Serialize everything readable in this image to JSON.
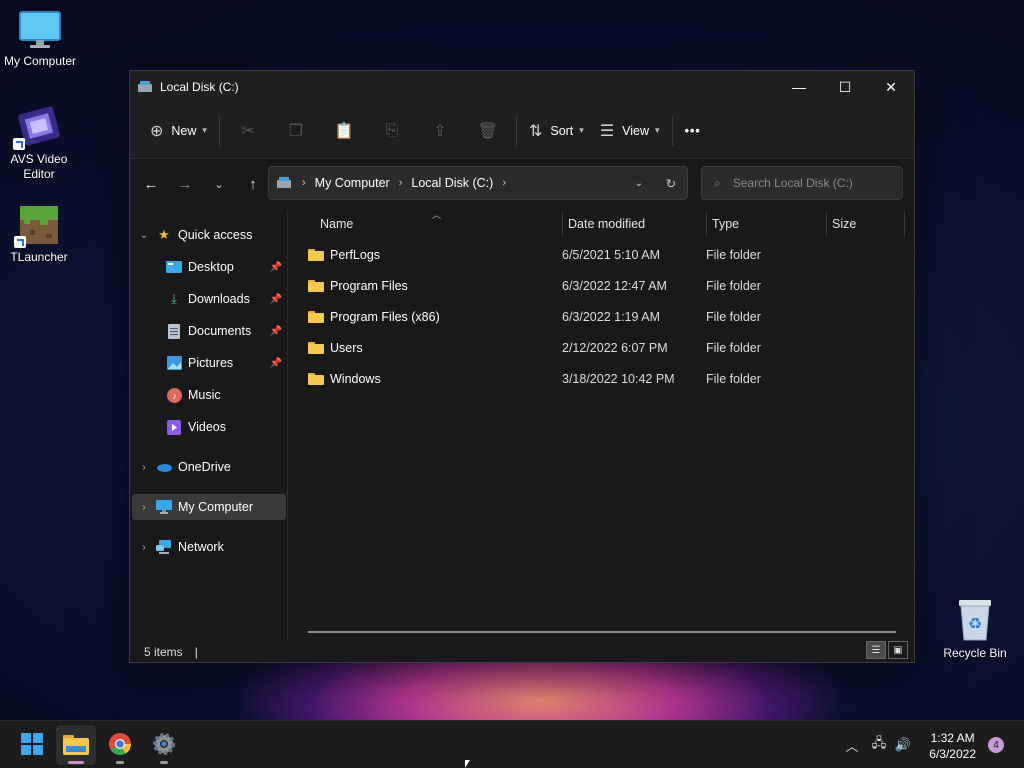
{
  "desktop": {
    "icons": [
      {
        "label": "My Computer",
        "icon": "monitor-icon"
      },
      {
        "label": "AVS Video Editor",
        "icon": "film-icon"
      },
      {
        "label": "TLauncher",
        "icon": "grass-block-icon"
      },
      {
        "label": "Recycle Bin",
        "icon": "recycle-bin-icon"
      }
    ]
  },
  "window": {
    "title": "Local Disk (C:)",
    "controls": {
      "minimize": "—",
      "maximize": "☐",
      "close": "✕"
    }
  },
  "toolbar": {
    "new_label": "New",
    "sort_label": "Sort",
    "view_label": "View",
    "more_label": "•••"
  },
  "address": {
    "crumbs": [
      "My Computer",
      "Local Disk (C:)"
    ],
    "search_placeholder": "Search Local Disk (C:)"
  },
  "sidebar": {
    "items": [
      {
        "label": "Quick access",
        "icon": "star-icon"
      },
      {
        "label": "Desktop",
        "icon": "desktop-icon"
      },
      {
        "label": "Downloads",
        "icon": "download-icon"
      },
      {
        "label": "Documents",
        "icon": "document-icon"
      },
      {
        "label": "Pictures",
        "icon": "picture-icon"
      },
      {
        "label": "Music",
        "icon": "music-icon"
      },
      {
        "label": "Videos",
        "icon": "video-icon"
      },
      {
        "label": "OneDrive",
        "icon": "cloud-icon"
      },
      {
        "label": "My Computer",
        "icon": "monitor-icon"
      },
      {
        "label": "Network",
        "icon": "network-icon"
      }
    ]
  },
  "columns": {
    "name": "Name",
    "date": "Date modified",
    "type": "Type",
    "size": "Size"
  },
  "files": [
    {
      "name": "PerfLogs",
      "date": "6/5/2021 5:10 AM",
      "type": "File folder",
      "size": ""
    },
    {
      "name": "Program Files",
      "date": "6/3/2022 12:47 AM",
      "type": "File folder",
      "size": ""
    },
    {
      "name": "Program Files (x86)",
      "date": "6/3/2022 1:19 AM",
      "type": "File folder",
      "size": ""
    },
    {
      "name": "Users",
      "date": "2/12/2022 6:07 PM",
      "type": "File folder",
      "size": ""
    },
    {
      "name": "Windows",
      "date": "3/18/2022 10:42 PM",
      "type": "File folder",
      "size": ""
    }
  ],
  "status": {
    "item_count": "5 items"
  },
  "taskbar": {
    "time": "1:32 AM",
    "date": "6/3/2022",
    "notification_count": "4"
  },
  "colors": {
    "accent": "#4aa3e0",
    "folder": "#f5c94b"
  }
}
